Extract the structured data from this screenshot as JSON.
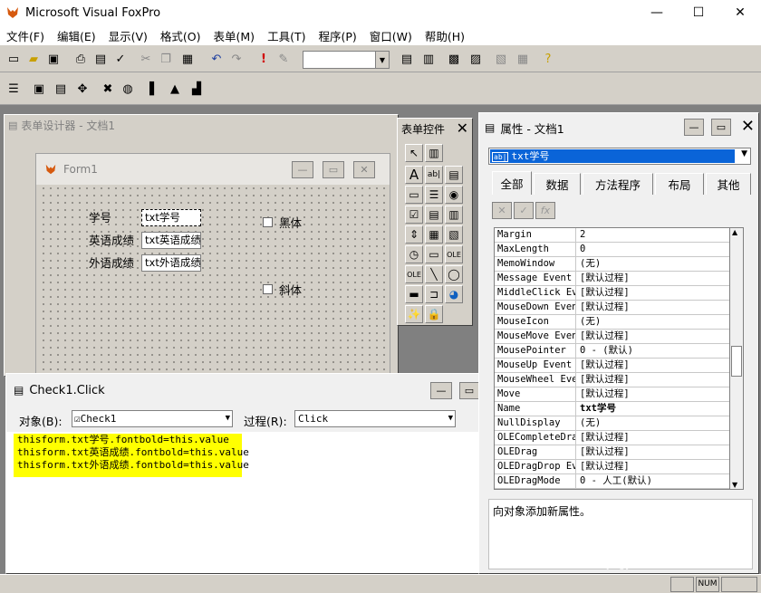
{
  "app": {
    "title": "Microsoft Visual FoxPro",
    "min": "—",
    "max": "☐",
    "close": "✕"
  },
  "menu": [
    "文件(F)",
    "编辑(E)",
    "显示(V)",
    "格式(O)",
    "表单(M)",
    "工具(T)",
    "程序(P)",
    "窗口(W)",
    "帮助(H)"
  ],
  "designer": {
    "title": "表单设计器 - 文档1"
  },
  "form": {
    "title": "Form1",
    "labels": [
      "学号",
      "英语成绩",
      "外语成绩"
    ],
    "fields": [
      "txt学号",
      "txt英语成绩",
      "txt外语成绩"
    ],
    "check1": "黑体",
    "check2": "斜体"
  },
  "toolbox": {
    "title": "表单控件"
  },
  "code": {
    "title": "Check1.Click",
    "object_label": "对象(B):",
    "object_value": "Check1",
    "proc_label": "过程(R):",
    "proc_value": "Click",
    "lines": [
      "thisform.txt学号.fontbold=this.value",
      "thisform.txt英语成绩.fontbold=this.value",
      "thisform.txt外语成绩.fontbold=this.value"
    ],
    "highlight": "#ffff00"
  },
  "props": {
    "title": "属性 - 文档1",
    "object": "txt学号",
    "tabs": [
      "全部",
      "数据",
      "方法程序",
      "布局",
      "其他"
    ],
    "rows": [
      {
        "name": "Margin",
        "value": "2"
      },
      {
        "name": "MaxLength",
        "value": "0"
      },
      {
        "name": "MemoWindow",
        "value": "(无)"
      },
      {
        "name": "Message Event",
        "value": "[默认过程]"
      },
      {
        "name": "MiddleClick Ev",
        "value": "[默认过程]"
      },
      {
        "name": "MouseDown Even",
        "value": "[默认过程]"
      },
      {
        "name": "MouseIcon",
        "value": "(无)"
      },
      {
        "name": "MouseMove Even",
        "value": "[默认过程]"
      },
      {
        "name": "MousePointer",
        "value": "0 - (默认)"
      },
      {
        "name": "MouseUp Event",
        "value": "[默认过程]"
      },
      {
        "name": "MouseWheel Eve",
        "value": "[默认过程]"
      },
      {
        "name": "Move",
        "value": "[默认过程]"
      },
      {
        "name": "Name",
        "value": "txt学号"
      },
      {
        "name": "NullDisplay",
        "value": "(无)"
      },
      {
        "name": "OLECompleteDra",
        "value": "[默认过程]"
      },
      {
        "name": "OLEDrag",
        "value": "[默认过程]"
      },
      {
        "name": "OLEDragDrop Ev",
        "value": "[默认过程]"
      },
      {
        "name": "OLEDragMode",
        "value": "0 - 人工(默认)"
      }
    ],
    "description": "向对象添加新属性。"
  },
  "status": {
    "num": "NUM"
  },
  "watermark": {
    "text": "Baidu经验",
    "sub": "jingyan.baidu.com"
  }
}
